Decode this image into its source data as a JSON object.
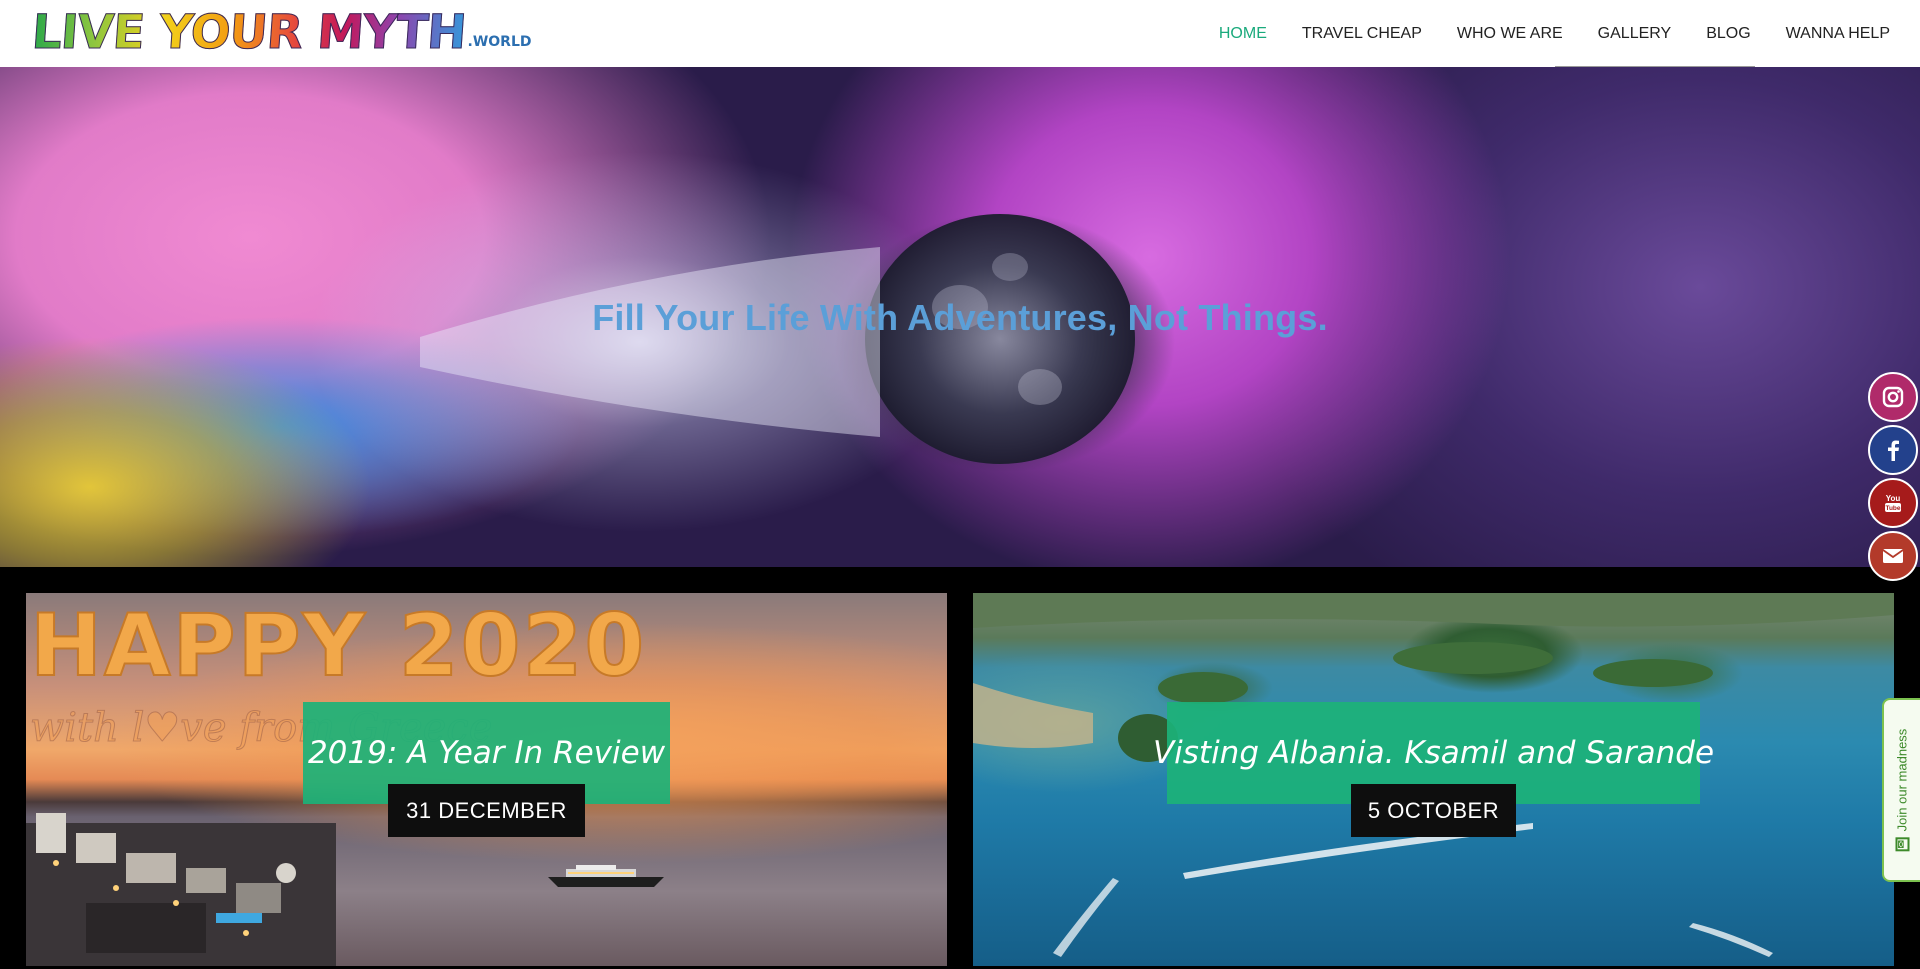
{
  "header": {
    "logo_main": "LIVE YOUR MYTH",
    "logo_suffix": ".WORLD",
    "nav": [
      {
        "label": "HOME",
        "active": true
      },
      {
        "label": "TRAVEL CHEAP",
        "active": false
      },
      {
        "label": "WHO WE ARE",
        "active": false
      },
      {
        "label": "GALLERY",
        "active": false
      },
      {
        "label": "BLOG",
        "active": false
      },
      {
        "label": "WANNA HELP",
        "active": false
      }
    ]
  },
  "hero": {
    "title": "Fill Your Life With Adventures, Not Things."
  },
  "posts": [
    {
      "title": "2019: A Year In Review",
      "date": "31 DECEMBER",
      "image_text_1": "HAPPY 2020",
      "image_text_2": "with l♥ve from Greece"
    },
    {
      "title": "Visting Albania. Ksamil and Sarande",
      "date": "5 OCTOBER"
    }
  ],
  "social": {
    "icons": [
      "instagram-icon",
      "facebook-icon",
      "youtube-icon",
      "mail-icon"
    ],
    "join_label": "Join our madness"
  },
  "colors": {
    "accent": "#1aaa7c",
    "title_box": "#1cb278",
    "hero_text": "#5b9fd8"
  }
}
